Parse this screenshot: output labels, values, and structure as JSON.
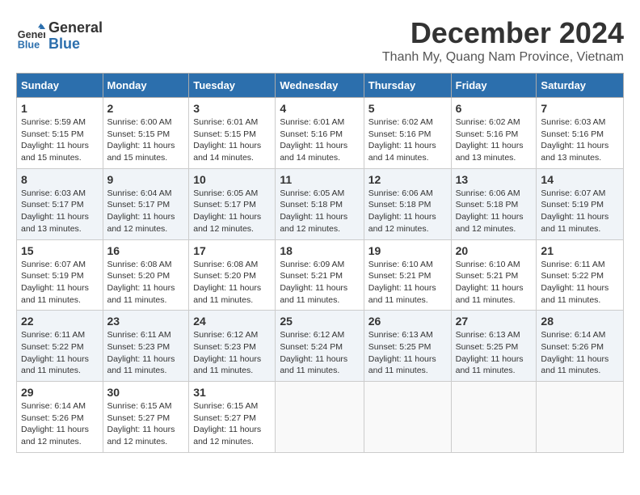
{
  "header": {
    "logo_line1": "General",
    "logo_line2": "Blue",
    "month": "December 2024",
    "location": "Thanh My, Quang Nam Province, Vietnam"
  },
  "calendar": {
    "days_of_week": [
      "Sunday",
      "Monday",
      "Tuesday",
      "Wednesday",
      "Thursday",
      "Friday",
      "Saturday"
    ],
    "weeks": [
      [
        {
          "day": "1",
          "info": "Sunrise: 5:59 AM\nSunset: 5:15 PM\nDaylight: 11 hours and 15 minutes."
        },
        {
          "day": "2",
          "info": "Sunrise: 6:00 AM\nSunset: 5:15 PM\nDaylight: 11 hours and 15 minutes."
        },
        {
          "day": "3",
          "info": "Sunrise: 6:01 AM\nSunset: 5:15 PM\nDaylight: 11 hours and 14 minutes."
        },
        {
          "day": "4",
          "info": "Sunrise: 6:01 AM\nSunset: 5:16 PM\nDaylight: 11 hours and 14 minutes."
        },
        {
          "day": "5",
          "info": "Sunrise: 6:02 AM\nSunset: 5:16 PM\nDaylight: 11 hours and 14 minutes."
        },
        {
          "day": "6",
          "info": "Sunrise: 6:02 AM\nSunset: 5:16 PM\nDaylight: 11 hours and 13 minutes."
        },
        {
          "day": "7",
          "info": "Sunrise: 6:03 AM\nSunset: 5:16 PM\nDaylight: 11 hours and 13 minutes."
        }
      ],
      [
        {
          "day": "8",
          "info": "Sunrise: 6:03 AM\nSunset: 5:17 PM\nDaylight: 11 hours and 13 minutes."
        },
        {
          "day": "9",
          "info": "Sunrise: 6:04 AM\nSunset: 5:17 PM\nDaylight: 11 hours and 12 minutes."
        },
        {
          "day": "10",
          "info": "Sunrise: 6:05 AM\nSunset: 5:17 PM\nDaylight: 11 hours and 12 minutes."
        },
        {
          "day": "11",
          "info": "Sunrise: 6:05 AM\nSunset: 5:18 PM\nDaylight: 11 hours and 12 minutes."
        },
        {
          "day": "12",
          "info": "Sunrise: 6:06 AM\nSunset: 5:18 PM\nDaylight: 11 hours and 12 minutes."
        },
        {
          "day": "13",
          "info": "Sunrise: 6:06 AM\nSunset: 5:18 PM\nDaylight: 11 hours and 12 minutes."
        },
        {
          "day": "14",
          "info": "Sunrise: 6:07 AM\nSunset: 5:19 PM\nDaylight: 11 hours and 11 minutes."
        }
      ],
      [
        {
          "day": "15",
          "info": "Sunrise: 6:07 AM\nSunset: 5:19 PM\nDaylight: 11 hours and 11 minutes."
        },
        {
          "day": "16",
          "info": "Sunrise: 6:08 AM\nSunset: 5:20 PM\nDaylight: 11 hours and 11 minutes."
        },
        {
          "day": "17",
          "info": "Sunrise: 6:08 AM\nSunset: 5:20 PM\nDaylight: 11 hours and 11 minutes."
        },
        {
          "day": "18",
          "info": "Sunrise: 6:09 AM\nSunset: 5:21 PM\nDaylight: 11 hours and 11 minutes."
        },
        {
          "day": "19",
          "info": "Sunrise: 6:10 AM\nSunset: 5:21 PM\nDaylight: 11 hours and 11 minutes."
        },
        {
          "day": "20",
          "info": "Sunrise: 6:10 AM\nSunset: 5:21 PM\nDaylight: 11 hours and 11 minutes."
        },
        {
          "day": "21",
          "info": "Sunrise: 6:11 AM\nSunset: 5:22 PM\nDaylight: 11 hours and 11 minutes."
        }
      ],
      [
        {
          "day": "22",
          "info": "Sunrise: 6:11 AM\nSunset: 5:22 PM\nDaylight: 11 hours and 11 minutes."
        },
        {
          "day": "23",
          "info": "Sunrise: 6:11 AM\nSunset: 5:23 PM\nDaylight: 11 hours and 11 minutes."
        },
        {
          "day": "24",
          "info": "Sunrise: 6:12 AM\nSunset: 5:23 PM\nDaylight: 11 hours and 11 minutes."
        },
        {
          "day": "25",
          "info": "Sunrise: 6:12 AM\nSunset: 5:24 PM\nDaylight: 11 hours and 11 minutes."
        },
        {
          "day": "26",
          "info": "Sunrise: 6:13 AM\nSunset: 5:25 PM\nDaylight: 11 hours and 11 minutes."
        },
        {
          "day": "27",
          "info": "Sunrise: 6:13 AM\nSunset: 5:25 PM\nDaylight: 11 hours and 11 minutes."
        },
        {
          "day": "28",
          "info": "Sunrise: 6:14 AM\nSunset: 5:26 PM\nDaylight: 11 hours and 11 minutes."
        }
      ],
      [
        {
          "day": "29",
          "info": "Sunrise: 6:14 AM\nSunset: 5:26 PM\nDaylight: 11 hours and 12 minutes."
        },
        {
          "day": "30",
          "info": "Sunrise: 6:15 AM\nSunset: 5:27 PM\nDaylight: 11 hours and 12 minutes."
        },
        {
          "day": "31",
          "info": "Sunrise: 6:15 AM\nSunset: 5:27 PM\nDaylight: 11 hours and 12 minutes."
        },
        null,
        null,
        null,
        null
      ]
    ]
  }
}
